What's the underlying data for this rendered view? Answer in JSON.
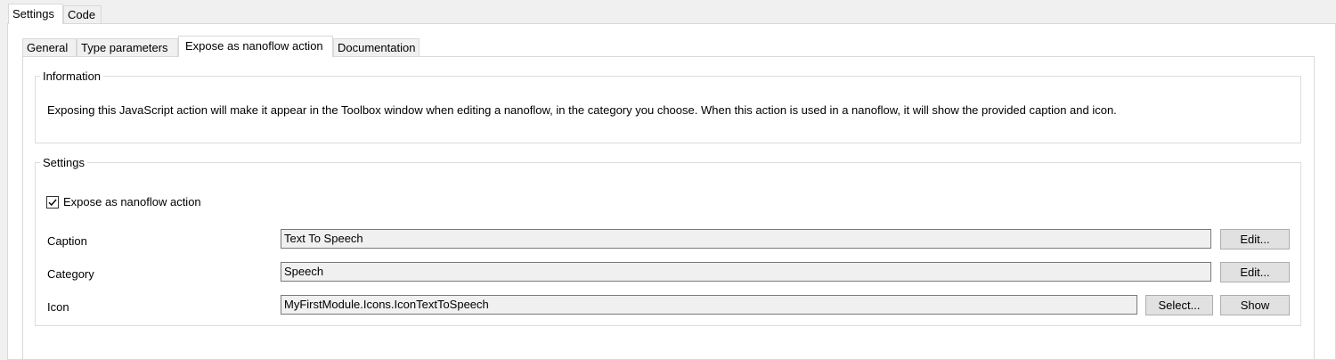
{
  "outer_tabs": [
    {
      "label": "Settings",
      "active": true
    },
    {
      "label": "Code",
      "active": false
    }
  ],
  "inner_tabs": [
    {
      "label": "General",
      "active": false
    },
    {
      "label": "Type parameters",
      "active": false
    },
    {
      "label": "Expose as nanoflow action",
      "active": true
    },
    {
      "label": "Documentation",
      "active": false
    }
  ],
  "information": {
    "legend": "Information",
    "text": "Exposing this JavaScript action will make it appear in the Toolbox window when editing a nanoflow, in the category you choose. When this action is used in a nanoflow, it will show the provided caption and icon."
  },
  "settings": {
    "legend": "Settings",
    "expose_checkbox": {
      "label": "Expose as nanoflow action",
      "checked": true
    },
    "caption": {
      "label": "Caption",
      "value": "Text To Speech",
      "edit_label": "Edit..."
    },
    "category": {
      "label": "Category",
      "value": "Speech",
      "edit_label": "Edit..."
    },
    "icon": {
      "label": "Icon",
      "value": "MyFirstModule.Icons.IconTextToSpeech",
      "select_label": "Select...",
      "show_label": "Show"
    }
  }
}
